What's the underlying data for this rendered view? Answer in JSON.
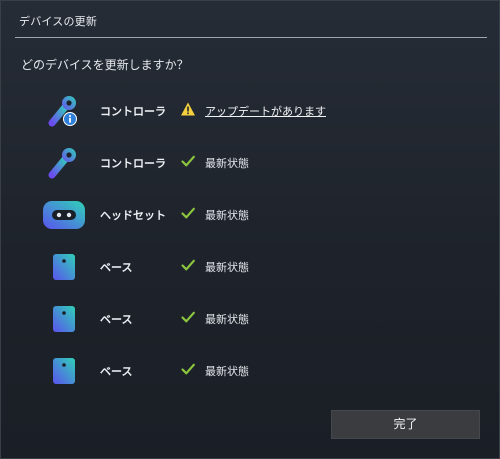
{
  "dialog": {
    "title": "デバイスの更新",
    "question": "どのデバイスを更新しますか？",
    "done_label": "完了"
  },
  "devices": [
    {
      "name": "コントローラ",
      "icon": "controller-icon",
      "icon_badge": "info-icon",
      "status": "アップデートがあります",
      "status_icon": "warning-icon",
      "status_is_link": true
    },
    {
      "name": "コントローラ",
      "icon": "controller-icon",
      "status": "最新状態",
      "status_icon": "check-icon",
      "status_is_link": false
    },
    {
      "name": "ヘッドセット",
      "icon": "headset-icon",
      "status": "最新状態",
      "status_icon": "check-icon",
      "status_is_link": false
    },
    {
      "name": "ベース",
      "icon": "base-station-icon",
      "status": "最新状態",
      "status_icon": "check-icon",
      "status_is_link": false
    },
    {
      "name": "ベース",
      "icon": "base-station-icon",
      "status": "最新状態",
      "status_icon": "check-icon",
      "status_is_link": false
    },
    {
      "name": "ベース",
      "icon": "base-station-icon",
      "status": "最新状態",
      "status_icon": "check-icon",
      "status_is_link": false
    }
  ],
  "colors": {
    "background": "#1e232b",
    "check": "#8cc63f",
    "warning": "#f4d03f",
    "info_badge": "#2f7fd9",
    "button": "#3a3c40"
  }
}
